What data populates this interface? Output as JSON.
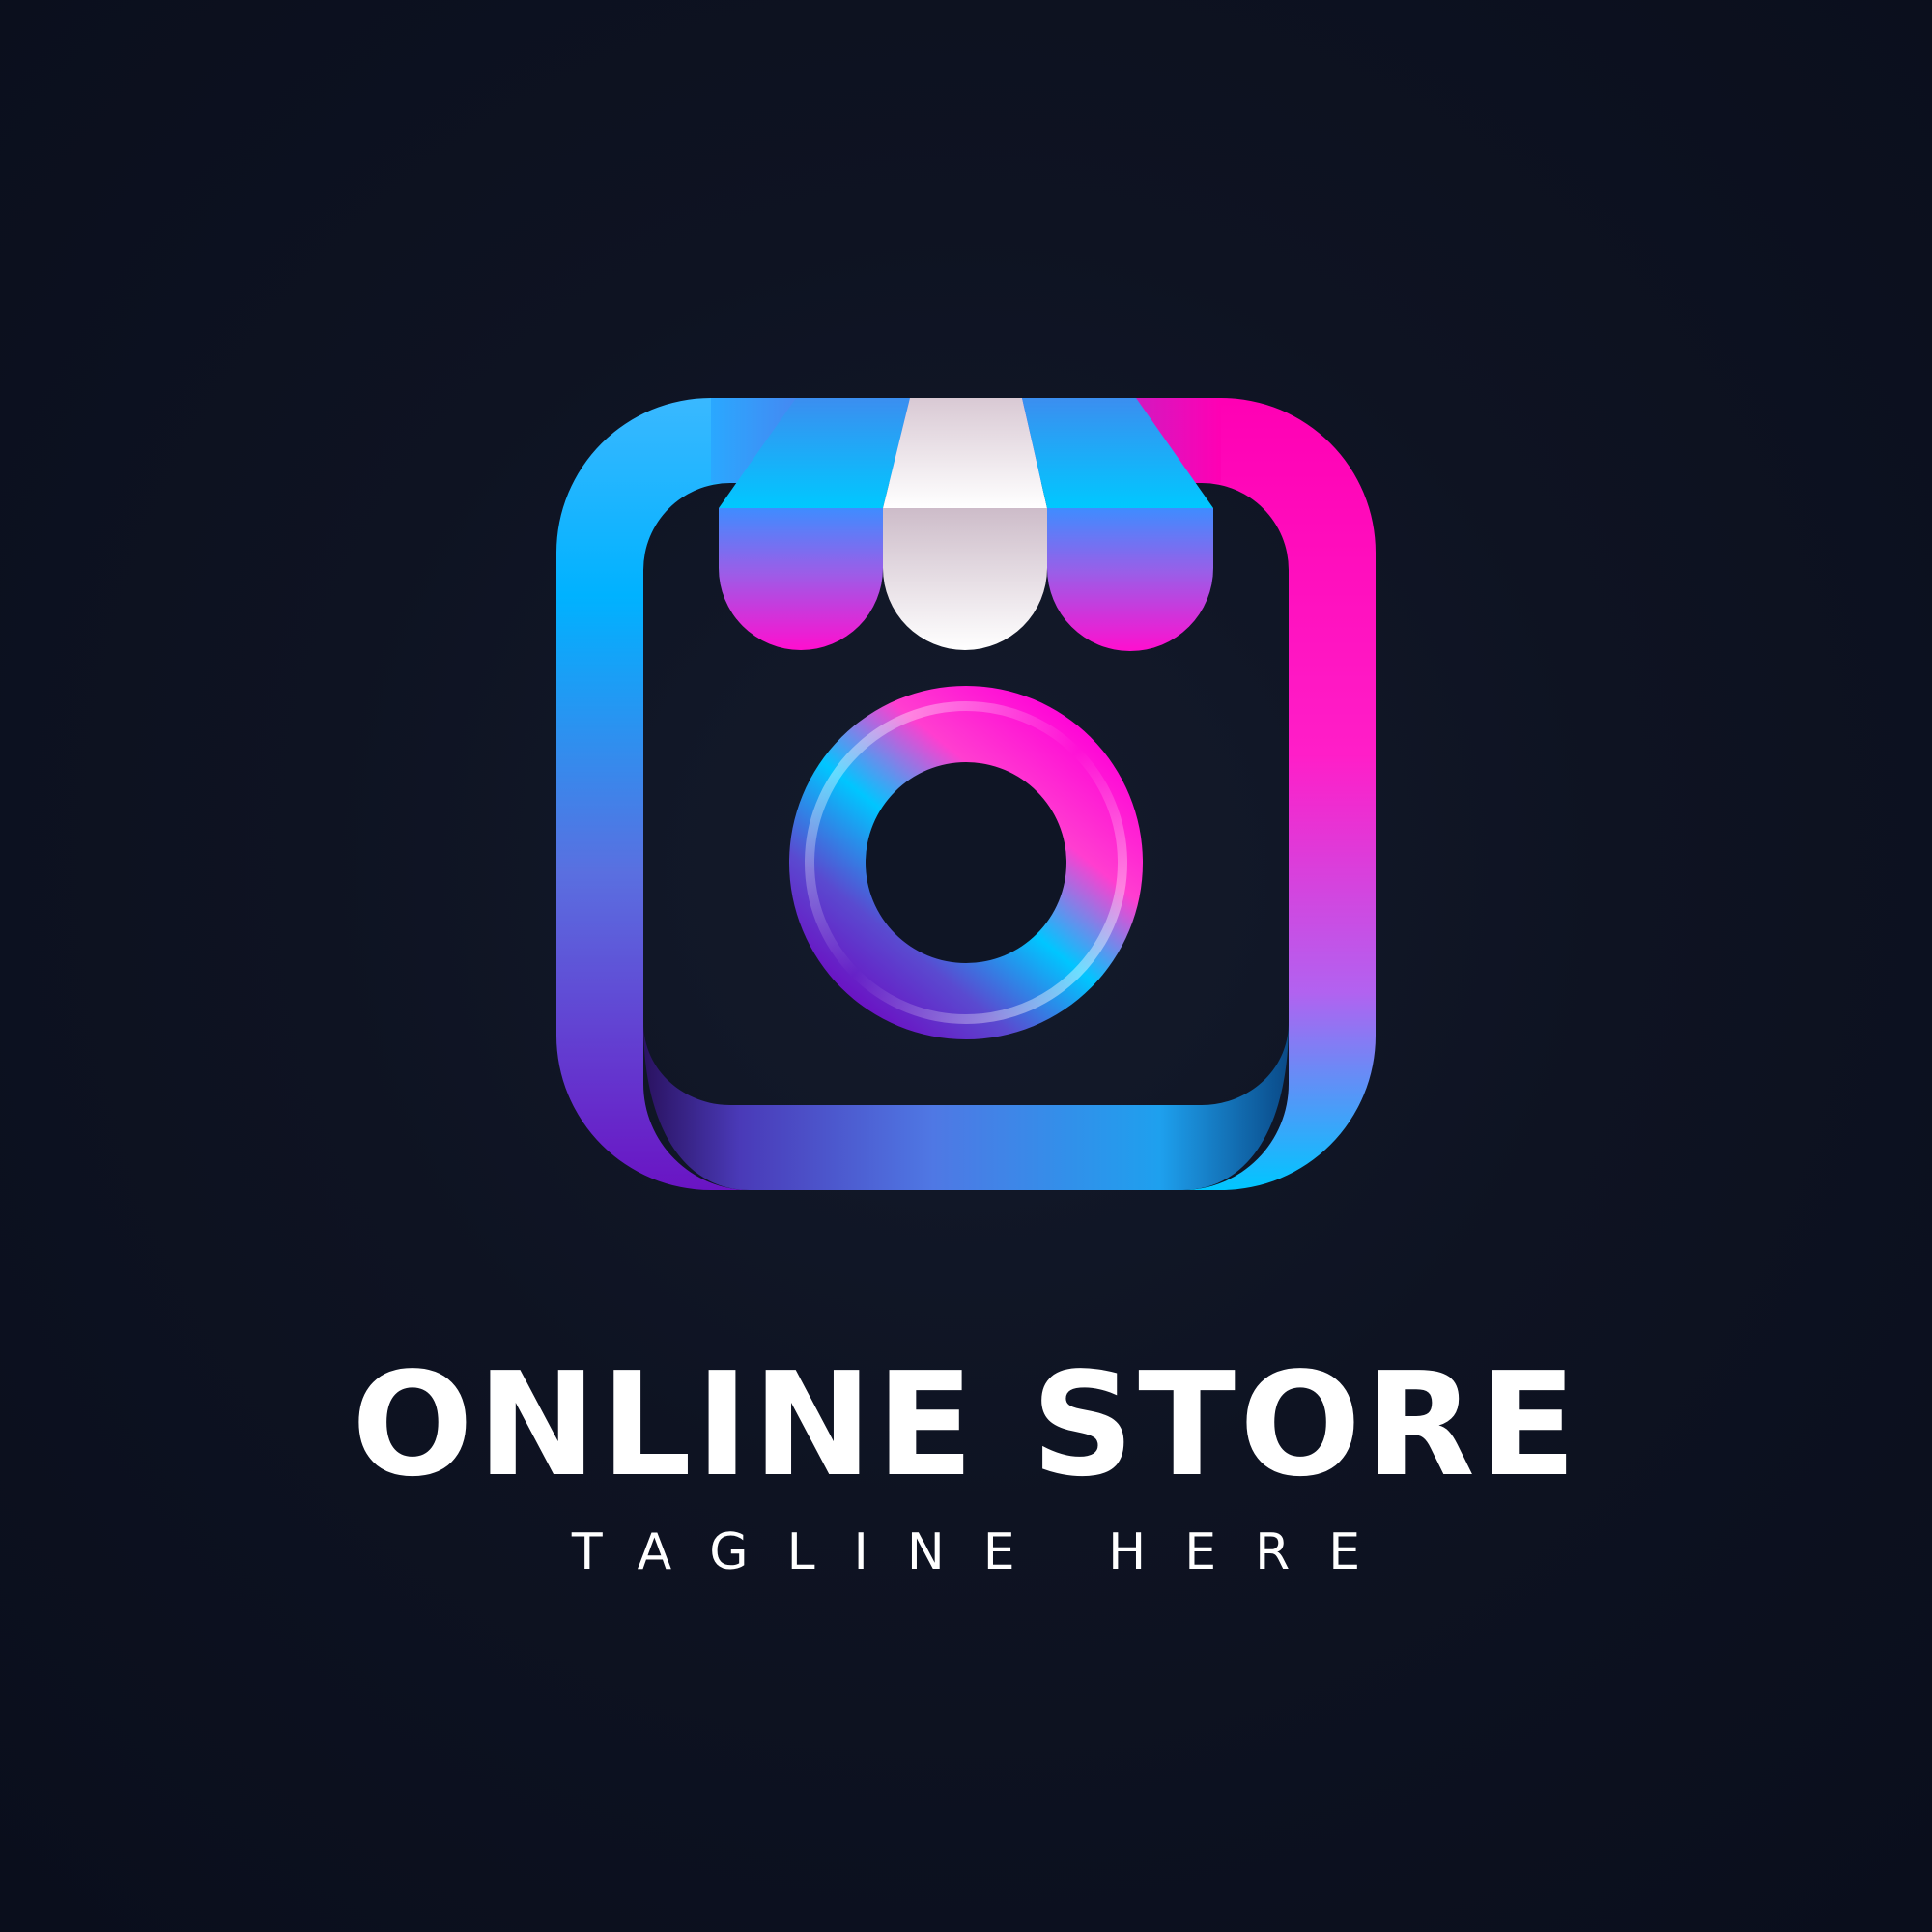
{
  "brand": {
    "name": "ONLINE STORE",
    "tagline": "TAGLINE HERE"
  },
  "colors": {
    "background": "#0e1322",
    "cyan": "#00c6ff",
    "blue": "#3f8cff",
    "magenta": "#ff00c8",
    "purple": "#6a14c4",
    "white": "#ffffff"
  },
  "icons": [
    "storefront-camera-logo-icon",
    "awning-icon",
    "camera-lens-icon"
  ]
}
